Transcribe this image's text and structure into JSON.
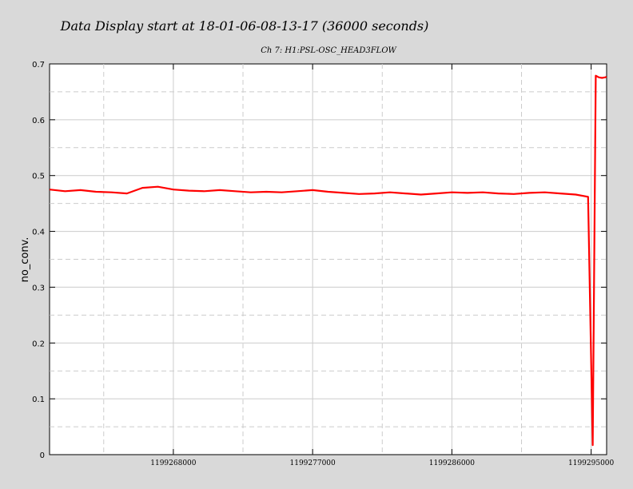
{
  "chart_data": {
    "type": "line",
    "title": "Data Display start at 18-01-06-08-13-17 (36000 seconds)",
    "subtitle": "Ch 7: H1:PSL-OSC_HEAD3FLOW",
    "xlabel": "",
    "ylabel": "no_conv.",
    "xlim": [
      1199260000,
      1199296000
    ],
    "ylim": [
      0,
      0.7
    ],
    "yticks": [
      0,
      0.1,
      0.2,
      0.3,
      0.4,
      0.5,
      0.6,
      0.7
    ],
    "ytick_labels": [
      "0",
      "0.1",
      "0.2",
      "0.3",
      "0.4",
      "0.5",
      "0.6",
      "0.7"
    ],
    "xticks": [
      1199268000,
      1199277000,
      1199286000,
      1199295000
    ],
    "xtick_labels": [
      "1199268000",
      "1199277000",
      "1199286000",
      "1199295000"
    ],
    "grid": true,
    "series": [
      {
        "color": "#ff0000",
        "x": [
          1199260000,
          1199261000,
          1199262000,
          1199263000,
          1199264000,
          1199265000,
          1199266000,
          1199267000,
          1199268000,
          1199269000,
          1199270000,
          1199271000,
          1199272000,
          1199273000,
          1199274000,
          1199275000,
          1199276000,
          1199277000,
          1199278000,
          1199279000,
          1199280000,
          1199281000,
          1199282000,
          1199283000,
          1199284000,
          1199285000,
          1199286000,
          1199287000,
          1199288000,
          1199289000,
          1199290000,
          1199291000,
          1199292000,
          1199293000,
          1199294000,
          1199294800,
          1199295100,
          1199295300,
          1199295500,
          1199295700,
          1199295900,
          1199296000
        ],
        "y": [
          0.475,
          0.472,
          0.474,
          0.471,
          0.47,
          0.468,
          0.478,
          0.48,
          0.475,
          0.473,
          0.472,
          0.474,
          0.472,
          0.47,
          0.471,
          0.47,
          0.472,
          0.474,
          0.471,
          0.469,
          0.467,
          0.468,
          0.47,
          0.468,
          0.466,
          0.468,
          0.47,
          0.469,
          0.47,
          0.468,
          0.467,
          0.469,
          0.47,
          0.468,
          0.466,
          0.462,
          0.017,
          0.679,
          0.676,
          0.675,
          0.676,
          0.677
        ]
      }
    ]
  }
}
